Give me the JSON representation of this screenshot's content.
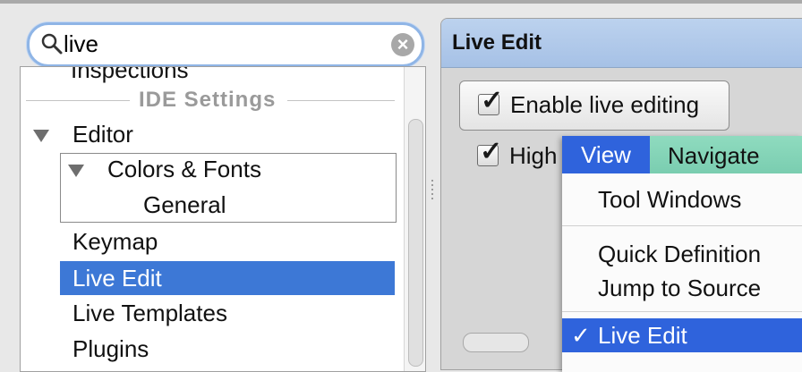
{
  "search": {
    "value": "live",
    "placeholder": ""
  },
  "tree": {
    "partial_item": "Inspections",
    "section_header": "IDE Settings",
    "items": [
      {
        "label": "Editor"
      },
      {
        "label": "Colors & Fonts"
      },
      {
        "label": "General"
      },
      {
        "label": "Keymap"
      },
      {
        "label": "Live Edit"
      },
      {
        "label": "Live Templates"
      },
      {
        "label": "Plugins"
      }
    ]
  },
  "panel": {
    "title": "Live Edit",
    "enable_label": "Enable live editing",
    "highlight_label": "High"
  },
  "menu": {
    "bar": [
      "View",
      "Navigate"
    ],
    "items": [
      "Tool Windows",
      "Quick Definition",
      "Jump to Source",
      "Live Edit"
    ],
    "checked_mark": "✓"
  },
  "colors": {
    "selection": "#3d78d6",
    "menu_selection": "#2f63dc",
    "header": "#a6c1e6",
    "menubar": "#7acdb0"
  }
}
